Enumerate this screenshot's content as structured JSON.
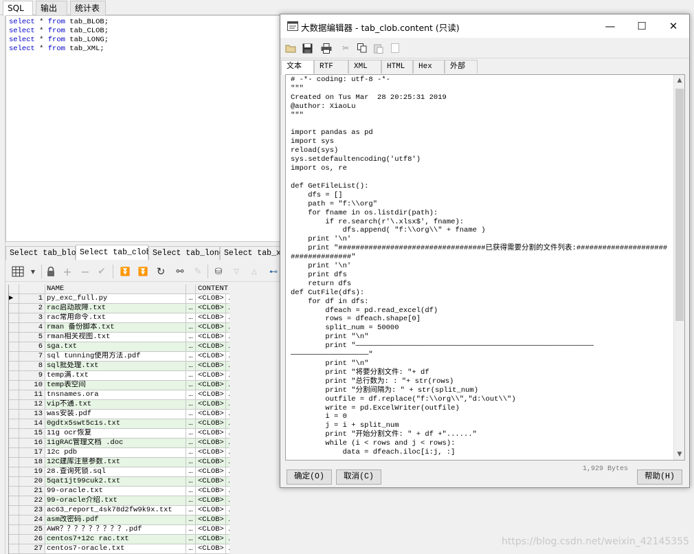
{
  "top_tabs": [
    "SQL",
    "输出",
    "统计表"
  ],
  "sql_lines": [
    {
      "kw1": "select",
      "star": "*",
      "kw2": "from",
      "rest": "tab_BLOB;"
    },
    {
      "kw1": "select",
      "star": "*",
      "kw2": "from",
      "rest": "tab_CLOB;"
    },
    {
      "kw1": "select",
      "star": "*",
      "kw2": "from",
      "rest": "tab_LONG;"
    },
    {
      "kw1": "select",
      "star": "*",
      "kw2": "from",
      "rest": "tab_XML;"
    }
  ],
  "result_tabs": [
    "Select tab_blob",
    "Select tab_clob",
    "Select tab_long",
    "Select tab_xml"
  ],
  "grid": {
    "headers": {
      "name": "NAME",
      "content": "CONTENT"
    },
    "dots": "…",
    "rows": [
      {
        "num": "1",
        "name": "py_exc_full.py",
        "content": "<CLOB>"
      },
      {
        "num": "2",
        "name": "rac启动故障.txt",
        "content": "<CLOB>"
      },
      {
        "num": "3",
        "name": "rac常用命令.txt",
        "content": "<CLOB>"
      },
      {
        "num": "4",
        "name": "rman 备份脚本.txt",
        "content": "<CLOB>"
      },
      {
        "num": "5",
        "name": "rman相关视图.txt",
        "content": "<CLOB>"
      },
      {
        "num": "6",
        "name": "sga.txt",
        "content": "<CLOB>"
      },
      {
        "num": "7",
        "name": "sql tunning使用方法.pdf",
        "content": "<CLOB>"
      },
      {
        "num": "8",
        "name": "sql批处理.txt",
        "content": "<CLOB>"
      },
      {
        "num": "9",
        "name": "temp满.txt",
        "content": "<CLOB>"
      },
      {
        "num": "10",
        "name": "temp表空间",
        "content": "<CLOB>"
      },
      {
        "num": "11",
        "name": "tnsnames.ora",
        "content": "<CLOB>"
      },
      {
        "num": "12",
        "name": "vip不通.txt",
        "content": "<CLOB>"
      },
      {
        "num": "13",
        "name": "was安装.pdf",
        "content": "<CLOB>"
      },
      {
        "num": "14",
        "name": "0gdtx5swt5c1s.txt",
        "content": "<CLOB>"
      },
      {
        "num": "15",
        "name": "11g ocr恢复",
        "content": "<CLOB>"
      },
      {
        "num": "16",
        "name": "11gRAC管理文档 .doc",
        "content": "<CLOB>"
      },
      {
        "num": "17",
        "name": "12c pdb",
        "content": "<CLOB>"
      },
      {
        "num": "18",
        "name": "12C建库注意参数.txt",
        "content": "<CLOB>"
      },
      {
        "num": "19",
        "name": "28.查询死锁.sql",
        "content": "<CLOB>"
      },
      {
        "num": "20",
        "name": "5qat1jt99cuk2.txt",
        "content": "<CLOB>"
      },
      {
        "num": "21",
        "name": "99-oracle.txt",
        "content": "<CLOB>"
      },
      {
        "num": "22",
        "name": "99-oracle介绍.txt",
        "content": "<CLOB>"
      },
      {
        "num": "23",
        "name": "ac63_report_4sk78d2fw9k9x.txt",
        "content": "<CLOB>"
      },
      {
        "num": "24",
        "name": "asm改密码.pdf",
        "content": "<CLOB>"
      },
      {
        "num": "25",
        "name": "AWR？？？？？？？？？.pdf",
        "content": "<CLOB>"
      },
      {
        "num": "26",
        "name": "centos7+12c rac.txt",
        "content": "<CLOB>"
      },
      {
        "num": "27",
        "name": "centos7-oracle.txt",
        "content": "<CLOB>"
      }
    ]
  },
  "dialog": {
    "title": "大数据编辑器 - tab_clob.content (只读)",
    "window_buttons": {
      "minimize": "—",
      "maximize": "☐",
      "close": "✕"
    },
    "tabs": [
      "文本",
      "RTF",
      "XML",
      "HTML",
      "Hex",
      "外部"
    ],
    "content_lines": [
      "# -*- coding: utf-8 -*-",
      "\"\"\"",
      "Created on Tus Mar  28 20:25:31 2019",
      "@author: XiaoLu",
      "\"\"\"",
      "",
      "import pandas as pd",
      "import sys",
      "reload(sys)",
      "sys.setdefaultencoding('utf8')",
      "import os, re",
      "",
      "def GetFileList():",
      "    dfs = []",
      "    path = \"f:\\\\org\"",
      "    for fname in os.listdir(path):",
      "        if re.search(r'\\.xlsx$', fname):",
      "            dfs.append( \"f:\\\\org\\\\\" + fname )",
      "    print '\\n'",
      "    print \"##################################已获得需要分割的文件列表:#####################",
      "##############\"",
      "    print '\\n'",
      "    print dfs",
      "    return dfs",
      "def CutFile(dfs):",
      "    for df in dfs:",
      "        dfeach = pd.read_excel(df)",
      "        rows = dfeach.shape[0]",
      "        split_num = 50000",
      "        print \"\\n\"",
      "        print \"———————————————————————————————————————————————————————",
      "——————————————————\"",
      "        print \"\\n\"",
      "        print \"将要分割文件: \"+ df",
      "        print \"总行数为: : \"+ str(rows)",
      "        print \"分割间隔为: \" + str(split_num)",
      "        outfile = df.replace(\"f:\\\\org\\\\\",\"d:\\out\\\\\")",
      "        write = pd.ExcelWriter(outfile)",
      "        i = 0",
      "        j = i + split_num",
      "        print \"开始分割文件: \" + df +\"......\"",
      "        while (i < rows and j < rows):",
      "            data = dfeach.iloc[i:j, :]"
    ],
    "size_label": "1,929 Bytes",
    "ok_label": "确定(O)",
    "cancel_label": "取消(C)",
    "help_label": "帮助(H)"
  },
  "watermark": "https://blog.csdn.net/weixin_42145355"
}
